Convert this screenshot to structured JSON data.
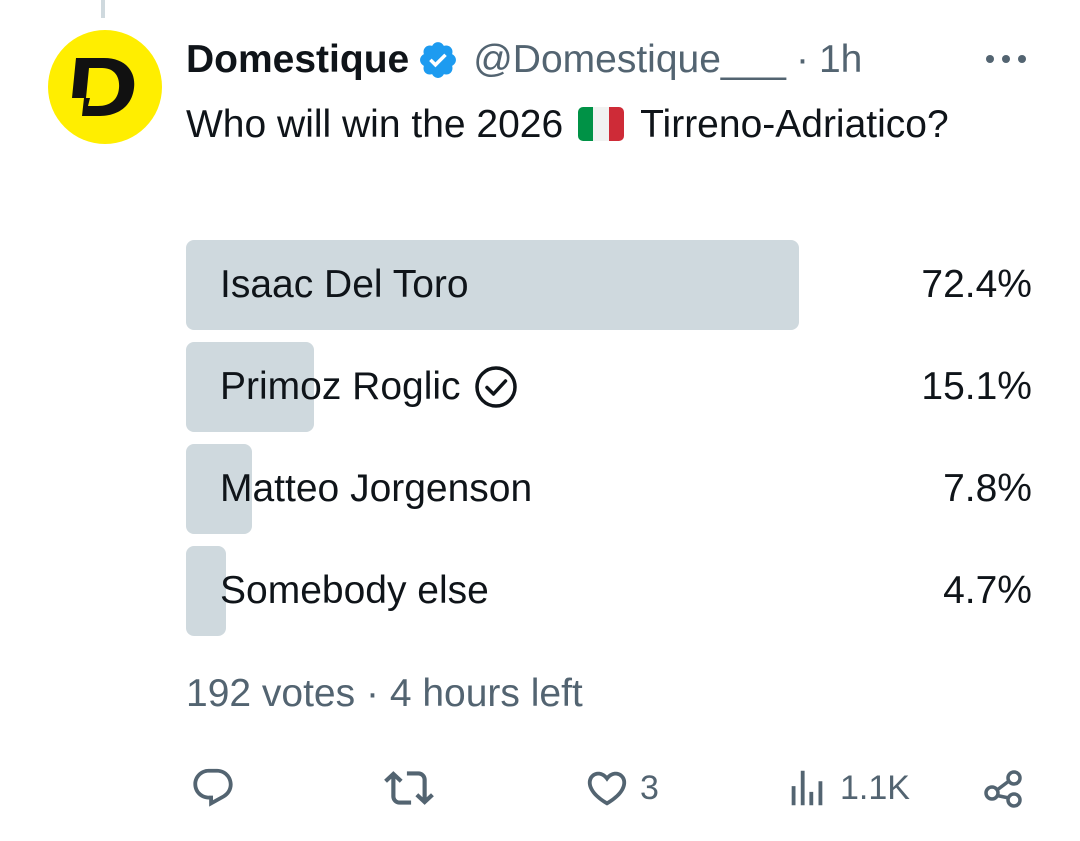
{
  "tweet": {
    "display_name": "Domestique",
    "avatar_letter": "D",
    "handle": "@Domestique___",
    "dot": "·",
    "time": "1h",
    "text_before_flag": "Who will win the 2026",
    "text_after_flag": "Tirreno-Adriatico?",
    "flag_icon": "italy-flag-icon",
    "verified_color": "#1d9bf0",
    "avatar_color": "#ffee00"
  },
  "poll": {
    "options": [
      {
        "label": "Isaac Del Toro",
        "percent_text": "72.4%",
        "percent": 72.4,
        "bar_fraction": 0.724,
        "selected": false
      },
      {
        "label": "Primoz Roglic",
        "percent_text": "15.1%",
        "percent": 15.1,
        "bar_fraction": 0.151,
        "selected": true
      },
      {
        "label": "Matteo Jorgenson",
        "percent_text": "7.8%",
        "percent": 7.8,
        "bar_fraction": 0.078,
        "selected": false
      },
      {
        "label": "Somebody else",
        "percent_text": "4.7%",
        "percent": 4.7,
        "bar_fraction": 0.047,
        "selected": false
      }
    ],
    "votes": "192 votes",
    "separator": "·",
    "time_left": "4 hours left",
    "bar_color": "#cfd9de"
  },
  "actions": {
    "reply_icon": "reply-icon",
    "repost_icon": "repost-icon",
    "like_icon": "heart-icon",
    "like_count": "3",
    "views_icon": "views-icon",
    "views_count": "1.1K",
    "share_icon": "share-icon"
  }
}
